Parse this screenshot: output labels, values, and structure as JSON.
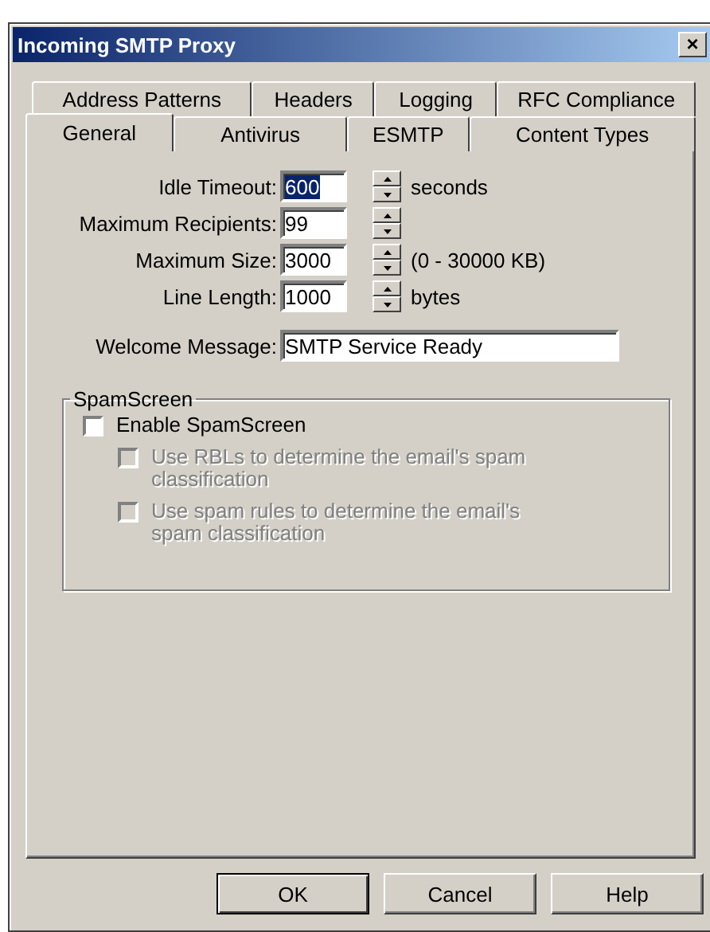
{
  "window": {
    "title": "Incoming SMTP Proxy",
    "close": "×"
  },
  "tab_rows": [
    {
      "tabs": [
        {
          "label": "Address Patterns",
          "selected": false
        },
        {
          "label": "Headers",
          "selected": false
        },
        {
          "label": "Logging",
          "selected": false
        },
        {
          "label": "RFC Compliance",
          "selected": false
        }
      ]
    },
    {
      "tabs": [
        {
          "label": "General",
          "selected": true
        },
        {
          "label": "Antivirus",
          "selected": false
        },
        {
          "label": "ESMTP",
          "selected": false
        },
        {
          "label": "Content Types",
          "selected": false
        }
      ]
    }
  ],
  "fields": [
    {
      "kind": "spinner",
      "label": "Idle Timeout:",
      "value": "600",
      "unit": "seconds",
      "selected": true
    },
    {
      "kind": "spinner",
      "label": "Maximum Recipients:",
      "value": "99",
      "selected": false
    },
    {
      "kind": "spinner",
      "label": "Maximum Size:",
      "value": "3000",
      "unit": "(0 - 30000 KB)",
      "selected": false
    },
    {
      "kind": "spinner",
      "label": "Line Length:",
      "value": "1000",
      "unit": "bytes",
      "selected": false
    },
    {
      "kind": "text",
      "label": "Welcome Message:",
      "value": "SMTP Service Ready"
    }
  ],
  "spamscreen": {
    "title": "SpamScreen",
    "options": [
      {
        "label": "Enable SpamScreen",
        "checked": false,
        "disabled": false,
        "indented": false
      },
      {
        "label": "Use RBLs to determine the email's spam classification",
        "checked": false,
        "disabled": true,
        "indented": true
      },
      {
        "label": "Use spam rules to determine the email's spam classification",
        "checked": false,
        "disabled": true,
        "indented": true
      }
    ]
  },
  "buttons": [
    {
      "label": "OK",
      "default": true
    },
    {
      "label": "Cancel",
      "default": false
    },
    {
      "label": "Help",
      "default": false
    }
  ]
}
